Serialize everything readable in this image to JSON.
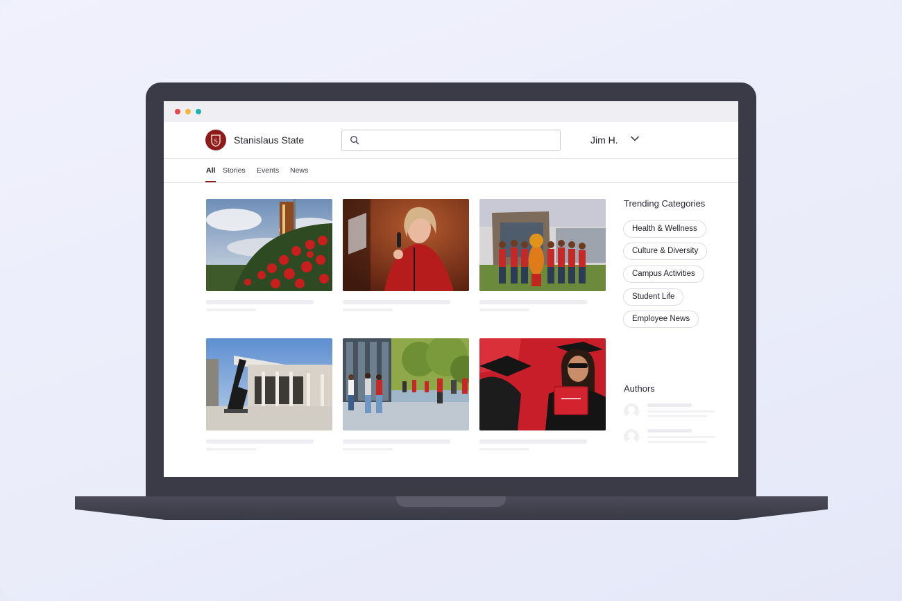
{
  "brand": {
    "name": "Stanislaus State",
    "color": "#8e1b1b"
  },
  "search": {
    "placeholder": ""
  },
  "user": {
    "name": "Jim H."
  },
  "tabs": [
    {
      "label": "All",
      "active": true
    },
    {
      "label": "Stories",
      "active": false
    },
    {
      "label": "Events",
      "active": false
    },
    {
      "label": "News",
      "active": false
    }
  ],
  "sidebar": {
    "trending_title": "Trending Categories",
    "categories": [
      "Health & Wellness",
      "Culture & Diversity",
      "Campus Activities",
      "Student Life",
      "Employee News"
    ],
    "authors_title": "Authors"
  },
  "cards": [
    {
      "image": "campus-banner-flowers-photo"
    },
    {
      "image": "speaker-at-podium-photo"
    },
    {
      "image": "students-with-mascot-photo"
    },
    {
      "image": "sculpture-building-photo"
    },
    {
      "image": "students-walking-photo"
    },
    {
      "image": "graduate-with-diploma-photo"
    }
  ],
  "window_dots": [
    "#e5484d",
    "#f5b73b",
    "#23b0a8"
  ]
}
